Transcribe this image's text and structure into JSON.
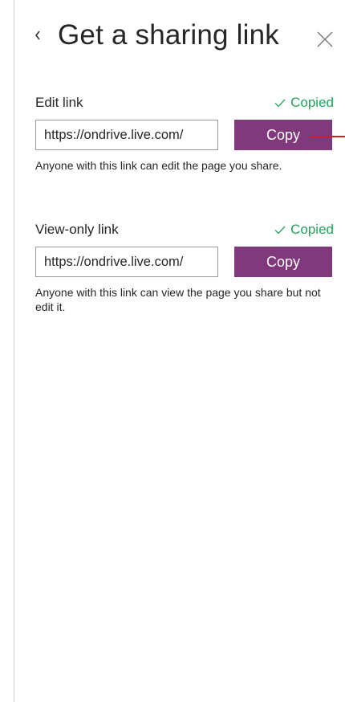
{
  "panel": {
    "title": "Get a sharing link",
    "back_icon": "chevron-left-icon",
    "close_icon": "close-icon"
  },
  "edit_link": {
    "label": "Edit link",
    "status": "Copied",
    "url_value": "https://ondrive.live.com/",
    "copy_label": "Copy",
    "description": "Anyone with this link can edit the page you share."
  },
  "view_link": {
    "label": "View-only link",
    "status": "Copied",
    "url_value": "https://ondrive.live.com/",
    "copy_label": "Copy",
    "description": "Anyone with this link can view the page you share but not edit it."
  },
  "colors": {
    "accent": "#80397b",
    "success": "#23a35a",
    "callout": "#d01f2a"
  }
}
